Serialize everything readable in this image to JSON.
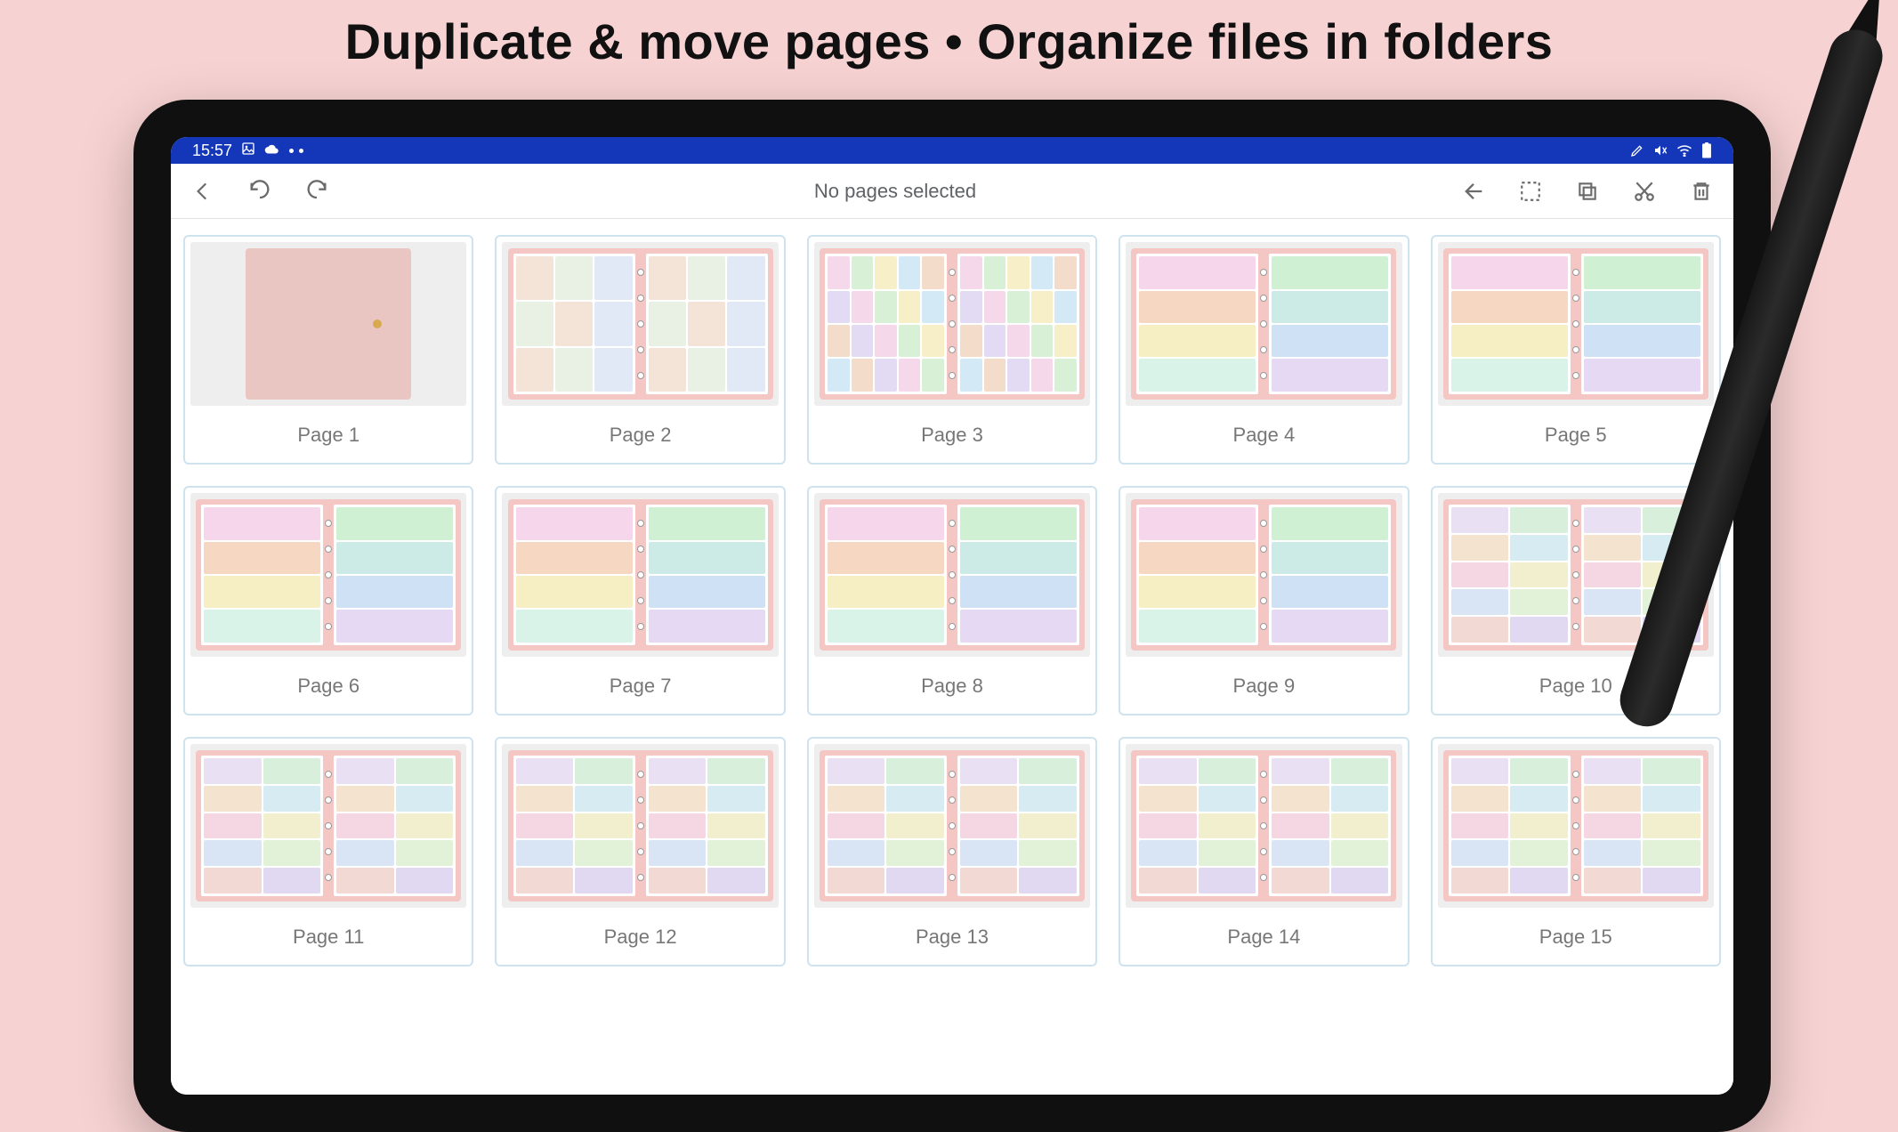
{
  "headline": "Duplicate & move pages  •  Organize files in folders",
  "statusbar": {
    "time": "15:57",
    "icons_left": [
      "image-icon",
      "cloud-icon"
    ],
    "icons_right": [
      "mute-icon",
      "wifi-icon",
      "battery-icon"
    ]
  },
  "toolbar": {
    "back": "Back",
    "undo": "Undo",
    "redo": "Redo",
    "title": "No pages selected",
    "close": "Close",
    "select_all": "Select all",
    "copy": "Copy",
    "cut": "Cut",
    "delete": "Delete"
  },
  "pages": [
    {
      "label": "Page 1",
      "variant": "cover"
    },
    {
      "label": "Page 2",
      "variant": "cal"
    },
    {
      "label": "Page 3",
      "variant": "month"
    },
    {
      "label": "Page 4",
      "variant": "weekly"
    },
    {
      "label": "Page 5",
      "variant": "weekly"
    },
    {
      "label": "Page 6",
      "variant": "weekly"
    },
    {
      "label": "Page 7",
      "variant": "weekly"
    },
    {
      "label": "Page 8",
      "variant": "weekly"
    },
    {
      "label": "Page 9",
      "variant": "weekly"
    },
    {
      "label": "Page 10",
      "variant": "dashboard"
    },
    {
      "label": "Page 11",
      "variant": "dashboard"
    },
    {
      "label": "Page 12",
      "variant": "dashboard"
    },
    {
      "label": "Page 13",
      "variant": "dashboard"
    },
    {
      "label": "Page 14",
      "variant": "dashboard"
    },
    {
      "label": "Page 15",
      "variant": "dashboard"
    }
  ]
}
